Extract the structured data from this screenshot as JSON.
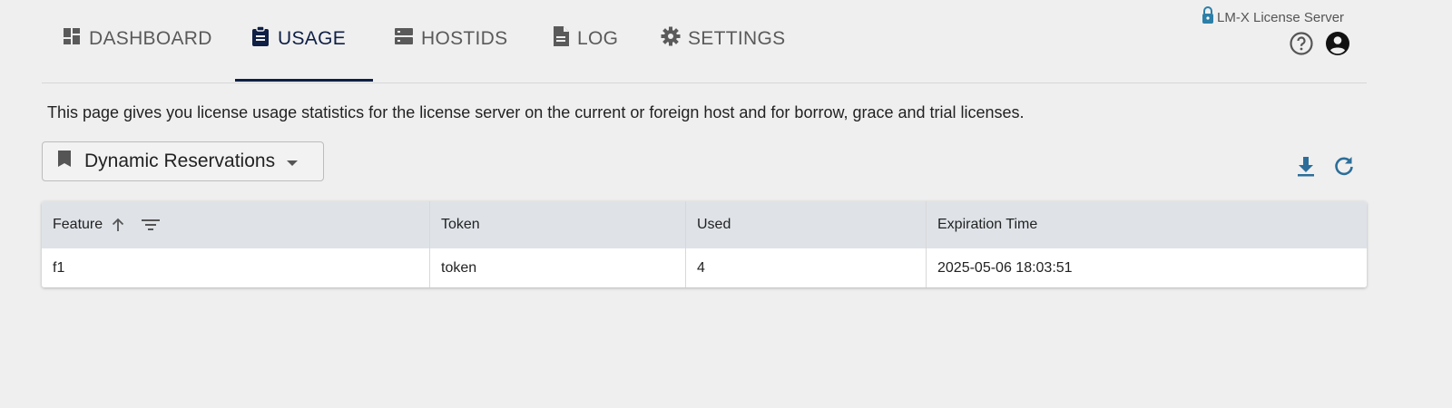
{
  "header": {
    "brand": "LM-X License Server",
    "icons": [
      "lock-icon",
      "help-icon",
      "account-icon"
    ]
  },
  "nav": {
    "tabs": [
      {
        "label": "DASHBOARD",
        "icon": "dashboard-icon",
        "active": false
      },
      {
        "label": "USAGE",
        "icon": "clipboard-icon",
        "active": true
      },
      {
        "label": "HOSTIDS",
        "icon": "server-icon",
        "active": false
      },
      {
        "label": "LOG",
        "icon": "document-icon",
        "active": false
      },
      {
        "label": "SETTINGS",
        "icon": "gear-icon",
        "active": false
      }
    ]
  },
  "main": {
    "description": "This page gives you license usage statistics for the license server on the current or foreign host and for borrow, grace and trial licenses.",
    "view_select": {
      "value": "Dynamic Reservations",
      "icon": "bookmark-icon"
    },
    "actions": [
      "download-icon",
      "refresh-icon"
    ],
    "table": {
      "columns": [
        "Feature",
        "Token",
        "Used",
        "Expiration Time"
      ],
      "rows": [
        [
          "f1",
          "token",
          "4",
          "2025-05-06 18:03:51"
        ]
      ]
    }
  },
  "colors": {
    "active_tab": "#0f1f45",
    "accent_icon": "#2c6e99",
    "header_row": "#dfe3e8",
    "background": "#efefef"
  }
}
